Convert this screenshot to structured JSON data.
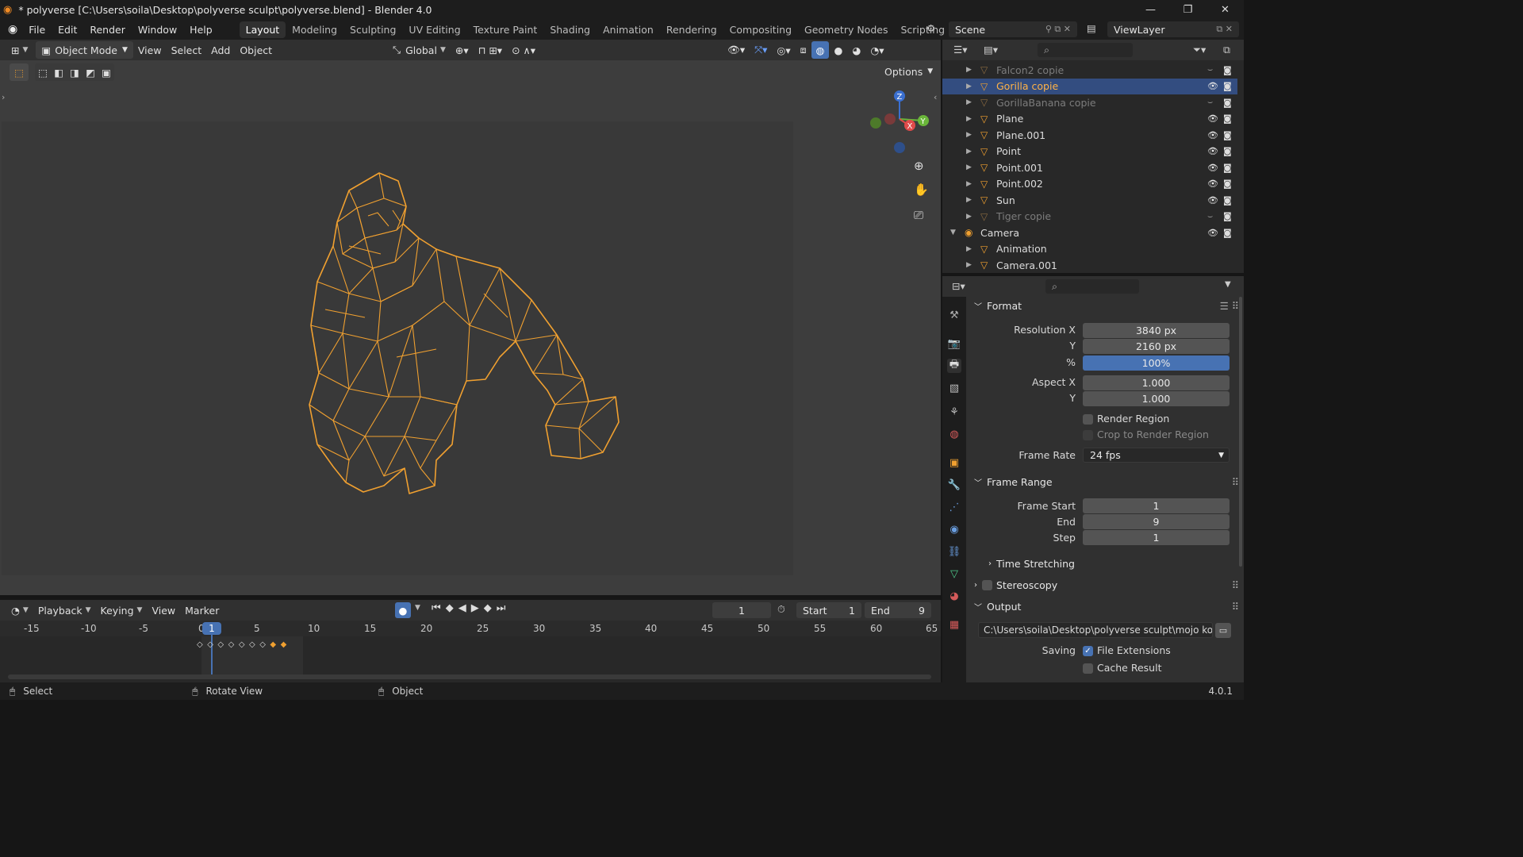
{
  "title": "* polyverse [C:\\Users\\soila\\Desktop\\polyverse sculpt\\polyverse.blend] - Blender 4.0",
  "menu": [
    "File",
    "Edit",
    "Render",
    "Window",
    "Help"
  ],
  "workspaces": [
    "Layout",
    "Modeling",
    "Sculpting",
    "UV Editing",
    "Texture Paint",
    "Shading",
    "Animation",
    "Rendering",
    "Compositing",
    "Geometry Nodes",
    "Scripting"
  ],
  "scene": "Scene",
  "view_layer": "ViewLayer",
  "viewport": {
    "mode": "Object Mode",
    "menus": [
      "View",
      "Select",
      "Add",
      "Object"
    ],
    "orientation": "Global",
    "options": "Options",
    "accent": "#f0a030"
  },
  "outliner": {
    "items": [
      {
        "name": "Falcon2 copie",
        "dim": true
      },
      {
        "name": "Gorilla copie",
        "selected": true
      },
      {
        "name": "GorillaBanana copie",
        "dim": true
      },
      {
        "name": "Plane"
      },
      {
        "name": "Plane.001"
      },
      {
        "name": "Point"
      },
      {
        "name": "Point.001"
      },
      {
        "name": "Point.002"
      },
      {
        "name": "Sun"
      },
      {
        "name": "Tiger copie",
        "dim": true
      },
      {
        "name": "Camera",
        "collection": true
      },
      {
        "name": "Animation"
      },
      {
        "name": "Camera.001"
      }
    ]
  },
  "props": {
    "format": {
      "label": "Format",
      "res_x_label": "Resolution X",
      "res_x": "3840 px",
      "y_label": "Y",
      "res_y": "2160 px",
      "pct_label": "%",
      "pct": "100%",
      "aspect_x_label": "Aspect X",
      "aspect_x": "1.000",
      "aspect_y_label": "Y",
      "aspect_y": "1.000",
      "render_region": "Render Region",
      "crop": "Crop to Render Region",
      "frame_rate_label": "Frame Rate",
      "frame_rate": "24 fps"
    },
    "frame_range": {
      "label": "Frame Range",
      "start_label": "Frame Start",
      "start": "1",
      "end_label": "End",
      "end": "9",
      "step_label": "Step",
      "step": "1"
    },
    "time_stretching": "Time Stretching",
    "stereoscopy": "Stereoscopy",
    "output": {
      "label": "Output",
      "path": "C:\\Users\\soila\\Desktop\\polyverse sculpt\\mojo kong\\",
      "saving_label": "Saving",
      "file_ext": "File Extensions",
      "cache": "Cache Result"
    }
  },
  "timeline": {
    "menus": [
      "Playback",
      "Keying",
      "View",
      "Marker"
    ],
    "current_frame": "1",
    "start_label": "Start",
    "start": "1",
    "end_label": "End",
    "end": "9",
    "ruler": [
      "-15",
      "-10",
      "-5",
      "0",
      "5",
      "10",
      "15",
      "20",
      "25",
      "30",
      "35",
      "40",
      "45",
      "50",
      "55",
      "60",
      "65"
    ],
    "current_marker": "1"
  },
  "status": {
    "select": "Select",
    "rotate": "Rotate View",
    "object": "Object",
    "version": "4.0.1"
  }
}
